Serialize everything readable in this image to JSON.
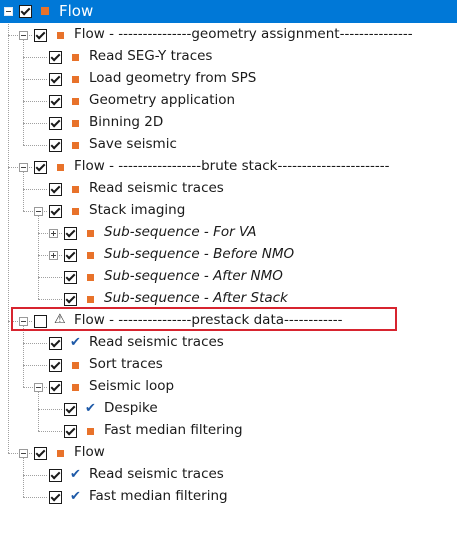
{
  "tree": {
    "items": [
      {
        "label": "Flow",
        "checked": true,
        "marker": "orange-square",
        "expander": "minus",
        "selected": true
      },
      {
        "label": "Flow - ---------------geometry assignment---------------",
        "checked": true,
        "marker": "orange-square",
        "expander": "minus"
      },
      {
        "label": "Read SEG-Y traces",
        "checked": true,
        "marker": "orange-square"
      },
      {
        "label": "Load geometry from SPS",
        "checked": true,
        "marker": "orange-square"
      },
      {
        "label": "Geometry application",
        "checked": true,
        "marker": "orange-square"
      },
      {
        "label": "Binning 2D",
        "checked": true,
        "marker": "orange-square"
      },
      {
        "label": "Save seismic",
        "checked": true,
        "marker": "orange-square"
      },
      {
        "label": "Flow - -----------------brute stack-----------------------",
        "checked": true,
        "marker": "orange-square",
        "expander": "minus"
      },
      {
        "label": "Read seismic traces",
        "checked": true,
        "marker": "orange-square"
      },
      {
        "label": "Stack imaging",
        "checked": true,
        "marker": "orange-square",
        "expander": "minus"
      },
      {
        "label": "Sub-sequence - For VA",
        "checked": true,
        "marker": "orange-square",
        "expander": "plus",
        "italic": true
      },
      {
        "label": "Sub-sequence - Before NMO",
        "checked": true,
        "marker": "orange-square",
        "expander": "plus",
        "italic": true
      },
      {
        "label": "Sub-sequence - After NMO",
        "checked": true,
        "marker": "orange-square",
        "italic": true
      },
      {
        "label": "Sub-sequence - After Stack",
        "checked": true,
        "marker": "orange-square",
        "italic": true
      },
      {
        "label": "Flow - ---------------prestack data------------",
        "checked": false,
        "marker": "warning-icon",
        "expander": "minus",
        "highlighted": true
      },
      {
        "label": "Read seismic traces",
        "checked": true,
        "marker": "blue-checkmark"
      },
      {
        "label": "Sort traces",
        "checked": true,
        "marker": "orange-square"
      },
      {
        "label": "Seismic loop",
        "checked": true,
        "marker": "orange-square",
        "expander": "minus"
      },
      {
        "label": "Despike",
        "checked": true,
        "marker": "blue-checkmark"
      },
      {
        "label": "Fast median filtering",
        "checked": true,
        "marker": "orange-square"
      },
      {
        "label": "Flow",
        "checked": true,
        "marker": "orange-square",
        "expander": "minus"
      },
      {
        "label": "Read seismic traces",
        "checked": true,
        "marker": "blue-checkmark"
      },
      {
        "label": "Fast median filtering",
        "checked": true,
        "marker": "blue-checkmark"
      }
    ]
  },
  "colors": {
    "selection": "#0078d7",
    "marker": "#e8722a",
    "checkmark": "#1e5aa8",
    "highlight_border": "#d7242f"
  }
}
